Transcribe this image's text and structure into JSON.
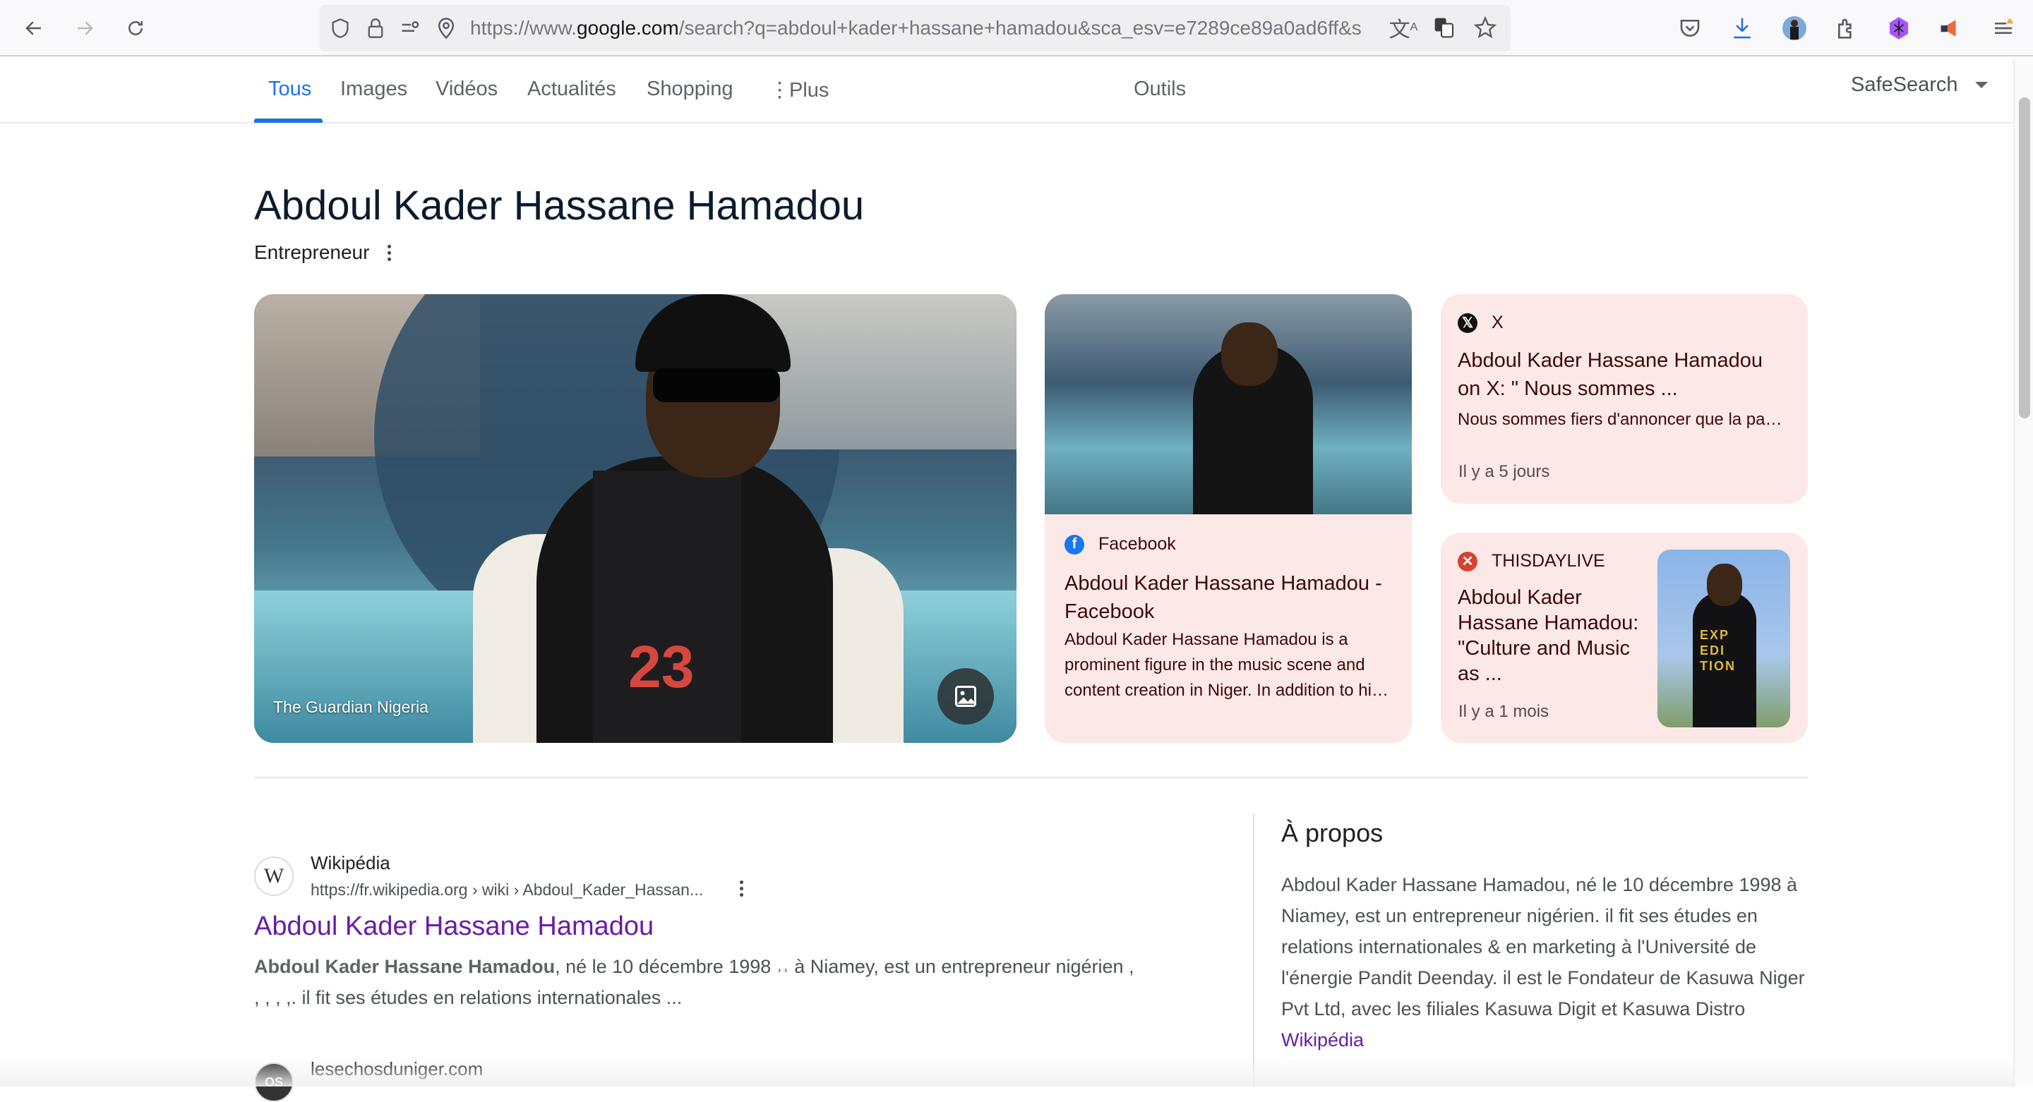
{
  "browser": {
    "url_prefix": "https://www.",
    "url_domain": "google.com",
    "url_rest": "/search?q=abdoul+kader+hassane+hamadou&sca_esv=e7289ce89a0ad6ff&s",
    "icons": [
      "back-icon",
      "forward-icon",
      "reload-icon",
      "shield-icon",
      "lock-icon",
      "permissions-icon",
      "location-icon",
      "translate-icon",
      "translate-page-icon",
      "bookmark-star-icon",
      "pocket-icon",
      "download-icon",
      "profile-avatar",
      "extensions-icon",
      "extension-purple-icon",
      "extension-megaphone-icon",
      "menu-icon"
    ]
  },
  "tabs": {
    "items": [
      "Tous",
      "Images",
      "Vidéos",
      "Actualités",
      "Shopping",
      "Plus"
    ],
    "active": "Tous",
    "tools": "Outils",
    "safesearch": "SafeSearch"
  },
  "entity": {
    "title": "Abdoul Kader Hassane Hamadou",
    "subtitle": "Entrepreneur"
  },
  "cards": {
    "main_image": {
      "source": "The Guardian Nigeria",
      "jersey": "23"
    },
    "facebook": {
      "source": "Facebook",
      "title": "Abdoul Kader Hassane Hamadou - Facebook",
      "snippet": "Abdoul Kader Hassane Hamadou is a prominent figure in the music scene and content creation in Niger. In addition to hi…"
    },
    "x": {
      "source": "X",
      "title": "Abdoul Kader Hassane Hamadou on X: \" Nous sommes ...",
      "snippet": "Nous sommes fiers d'annoncer que la pa…",
      "time": "Il y a 5 jours"
    },
    "thisday": {
      "source": "THISDAYLIVE",
      "title": "Abdoul Kader Hassane Hamadou: \"Culture and Music as ...",
      "time": "Il y a 1 mois",
      "shirt_text": "EXP EDI TION"
    }
  },
  "results": [
    {
      "site": "Wikipédia",
      "favicon": "W",
      "url": "https://fr.wikipedia.org › wiki › Abdoul_Kader_Hassan...",
      "title": "Abdoul Kader Hassane Hamadou",
      "snippet_bold": "Abdoul Kader Hassane Hamadou",
      "snippet_rest": ", né le 10 décembre 1998 ˒˒ à Niamey, est un entrepreneur nigérien , , , , ,. il fit ses études en relations internationales ..."
    },
    {
      "site": "lesechosduniger.com",
      "favicon": "OS"
    }
  ],
  "about": {
    "title": "À propos",
    "text": "Abdoul Kader Hassane Hamadou, né le 10 décembre 1998 à Niamey, est un entrepreneur nigérien. il fit ses études en relations internationales & en marketing à l'Université de l'énergie Pandit Deenday. il est le Fondateur de Kasuwa Niger Pvt Ltd, avec les filiales Kasuwa Digit et Kasuwa Distro ",
    "link": "Wikipédia"
  },
  "colors": {
    "accent": "#1a73e8",
    "visited_link": "#681da8",
    "card_bg": "#fce8e6"
  }
}
